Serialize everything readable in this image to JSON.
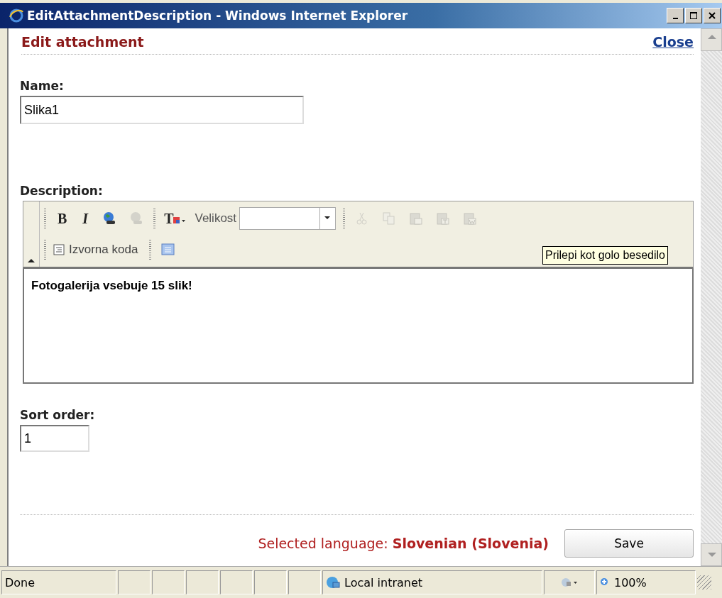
{
  "window": {
    "title": "EditAttachmentDescription - Windows Internet Explorer"
  },
  "page": {
    "heading": "Edit attachment",
    "close_link": "Close"
  },
  "name_field": {
    "label": "Name:",
    "value": "Slika1"
  },
  "description": {
    "label": "Description:",
    "toolbar_rows": [
      [
        {
          "kind": "bold",
          "glyph": "B",
          "disabled": false
        },
        {
          "kind": "italic",
          "glyph": "I",
          "disabled": false
        },
        {
          "kind": "link",
          "disabled": false
        },
        {
          "kind": "unlink",
          "disabled": true
        },
        {
          "kind": "sep"
        },
        {
          "kind": "textcolor",
          "glyph": "T",
          "disabled": false
        },
        {
          "kind": "fontsize",
          "label": "Velikost"
        },
        {
          "kind": "sep"
        },
        {
          "kind": "cut",
          "disabled": true
        },
        {
          "kind": "copy",
          "disabled": true
        },
        {
          "kind": "paste",
          "disabled": true
        },
        {
          "kind": "pastetext",
          "disabled": true
        },
        {
          "kind": "pasteword",
          "disabled": true
        }
      ],
      [
        {
          "kind": "source",
          "label": "Izvorna koda"
        },
        {
          "kind": "sep"
        },
        {
          "kind": "template",
          "disabled": false
        }
      ]
    ],
    "tooltip": "Prilepi kot golo besedilo",
    "content": "Fotogalerija vsebuje 15 slik!"
  },
  "sort_field": {
    "label": "Sort order:",
    "value": "1"
  },
  "footer": {
    "language_label": "Selected language:",
    "language_value": "Slovenian (Slovenia)",
    "save_button": "Save"
  },
  "status_bar": {
    "status": "Done",
    "zone": "Local intranet",
    "zoom": "100%"
  }
}
